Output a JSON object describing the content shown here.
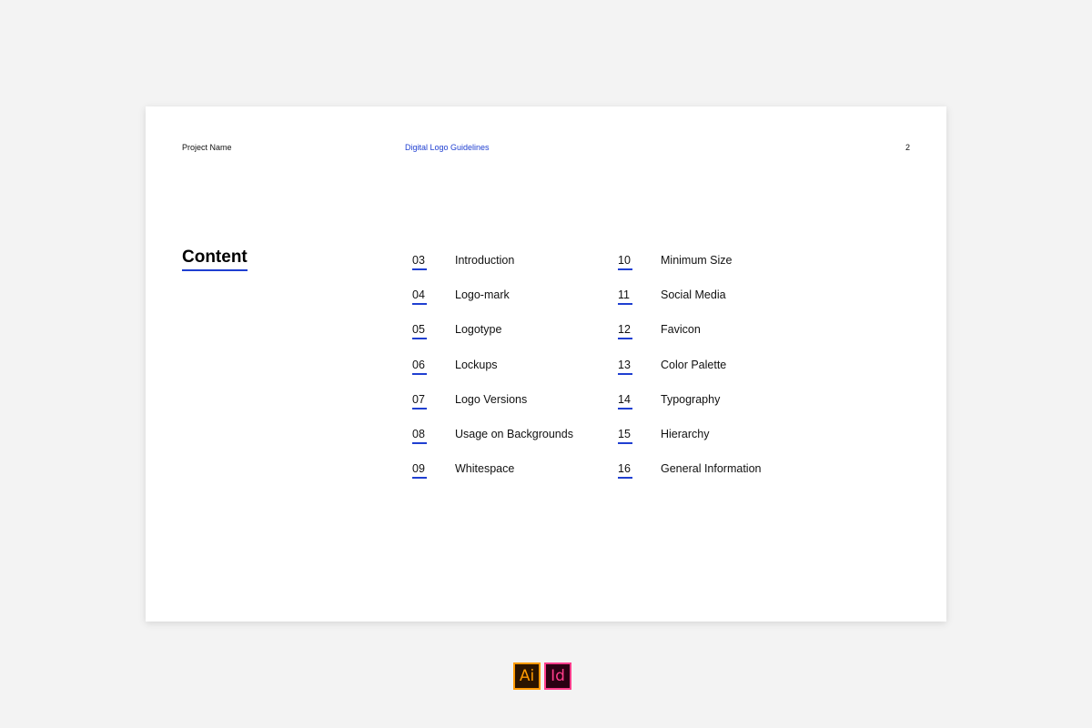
{
  "header": {
    "project_name": "Project Name",
    "document_title": "Digital Logo Guidelines",
    "page_number": "2"
  },
  "section_title": "Content",
  "toc": {
    "column1": [
      {
        "num": "03",
        "label": "Introduction"
      },
      {
        "num": "04",
        "label": "Logo-mark"
      },
      {
        "num": "05",
        "label": "Logotype"
      },
      {
        "num": "06",
        "label": "Lockups"
      },
      {
        "num": "07",
        "label": "Logo Versions"
      },
      {
        "num": "08",
        "label": "Usage on Backgrounds"
      },
      {
        "num": "09",
        "label": "Whitespace"
      }
    ],
    "column2": [
      {
        "num": "10",
        "label": "Minimum Size"
      },
      {
        "num": "11",
        "label": "Social Media"
      },
      {
        "num": "12",
        "label": "Favicon"
      },
      {
        "num": "13",
        "label": "Color Palette"
      },
      {
        "num": "14",
        "label": "Typography"
      },
      {
        "num": "15",
        "label": "Hierarchy"
      },
      {
        "num": "16",
        "label": "General Information"
      }
    ]
  },
  "apps": [
    {
      "label": "Ai",
      "icon": "adobe-illustrator-icon",
      "color": "#ff9a00"
    },
    {
      "label": "Id",
      "icon": "adobe-indesign-icon",
      "color": "#ff3d8b"
    }
  ],
  "colors": {
    "accent": "#1f3fd1",
    "background": "#f3f3f3",
    "page": "#ffffff"
  }
}
